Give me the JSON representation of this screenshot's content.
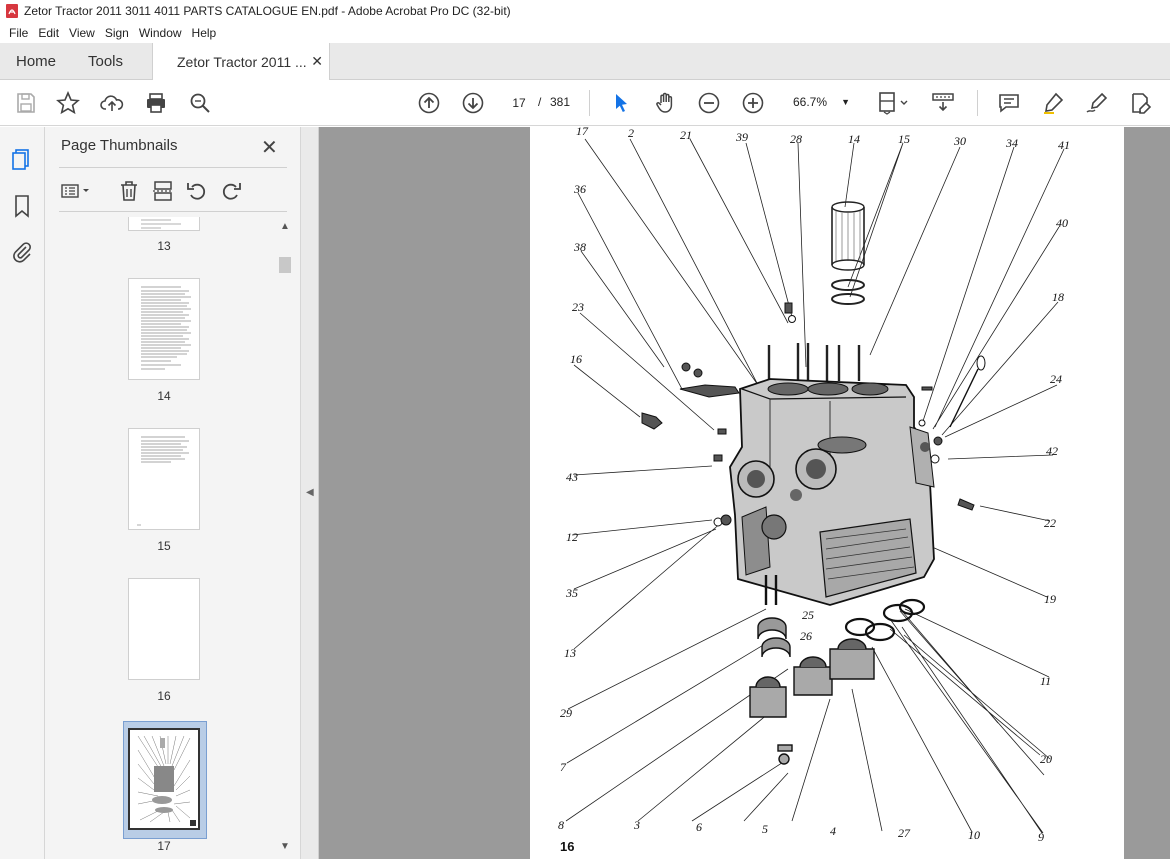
{
  "window": {
    "title": "Zetor Tractor 2011 3011 4011 PARTS CATALOGUE EN.pdf - Adobe Acrobat Pro DC (32-bit)"
  },
  "menu": {
    "items": [
      "File",
      "Edit",
      "View",
      "Sign",
      "Window",
      "Help"
    ]
  },
  "tabs": {
    "home": "Home",
    "tools": "Tools",
    "document": "Zetor Tractor 2011 ...",
    "close": "✕"
  },
  "toolbar": {
    "current_page": "17",
    "separator": "/",
    "total_pages": "381",
    "zoom": "66.7%",
    "zoom_dropdown": "▼"
  },
  "panel": {
    "title": "Page Thumbnails",
    "close": "✕",
    "thumbnails": [
      {
        "label": "13"
      },
      {
        "label": "14"
      },
      {
        "label": "15"
      },
      {
        "label": "16"
      },
      {
        "label": "17",
        "selected": true
      }
    ]
  },
  "collapse": {
    "arrow": "◀"
  },
  "document": {
    "page_number": "16",
    "callouts": [
      "17",
      "2",
      "21",
      "39",
      "28",
      "14",
      "15",
      "30",
      "34",
      "41",
      "36",
      "40",
      "38",
      "18",
      "23",
      "24",
      "16",
      "42",
      "43",
      "22",
      "12",
      "19",
      "35",
      "25",
      "26",
      "11",
      "13",
      "29",
      "20",
      "7",
      "8",
      "3",
      "6",
      "5",
      "4",
      "27",
      "10",
      "9"
    ]
  },
  "colors": {
    "accent": "#1473e6",
    "tab_bar": "#e9e9e9",
    "viewport_bg": "#9a9a9a",
    "selection": "#b9cde6"
  }
}
